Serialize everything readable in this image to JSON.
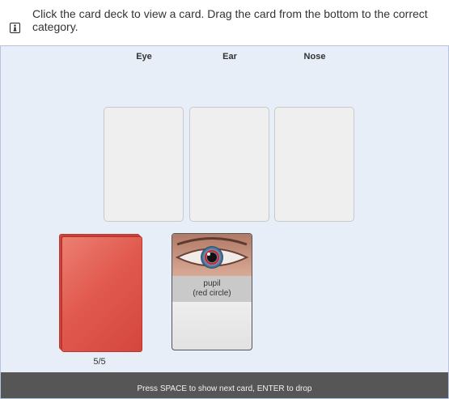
{
  "instructions": {
    "icon": "info-icon",
    "text": "Click the card deck to view a card. Drag the card from the bottom to the correct category."
  },
  "categories": [
    "Eye",
    "Ear",
    "Nose"
  ],
  "deck": {
    "count": "5/5",
    "color": "#e15a4f"
  },
  "current_card": {
    "image": "eye-closeup-image",
    "caption_line1": "pupil",
    "caption_line2": "(red circle)"
  },
  "status_bar": {
    "text": "Press SPACE to show next card, ENTER to drop"
  },
  "colors": {
    "panel_background": "#e8eef8",
    "deck_red": "#e15a4f",
    "status_bar": "#565656",
    "slot_background": "#efefef"
  }
}
